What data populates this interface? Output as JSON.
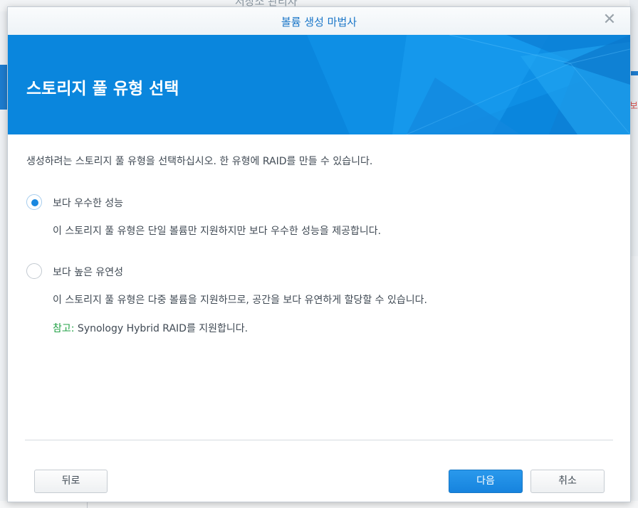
{
  "background": {
    "partial_title": "저장소 관리자",
    "right_edge_text": "보"
  },
  "dialog": {
    "title": "볼륨 생성 마법사",
    "close_icon": "close-icon",
    "banner_title": "스토리지 풀 유형 선택",
    "description": "생성하려는 스토리지 풀 유형을 선택하십시오. 한 유형에 RAID를 만들 수 있습니다.",
    "options": [
      {
        "label": "보다 우수한 성능",
        "description": "이 스토리지 풀 유형은 단일 볼륨만 지원하지만 보다 우수한 성능을 제공합니다.",
        "selected": true
      },
      {
        "label": "보다 높은 유연성",
        "description": "이 스토리지 풀 유형은 다중 볼륨을 지원하므로, 공간을 보다 유연하게 할당할 수 있습니다.",
        "note_label": "참고:",
        "note_text": " Synology Hybrid RAID를 지원합니다.",
        "selected": false
      }
    ],
    "buttons": {
      "back": "뒤로",
      "next": "다음",
      "cancel": "취소"
    }
  },
  "colors": {
    "accent": "#1a88e0",
    "banner": "#0b8be0",
    "note_green": "#22a145"
  }
}
